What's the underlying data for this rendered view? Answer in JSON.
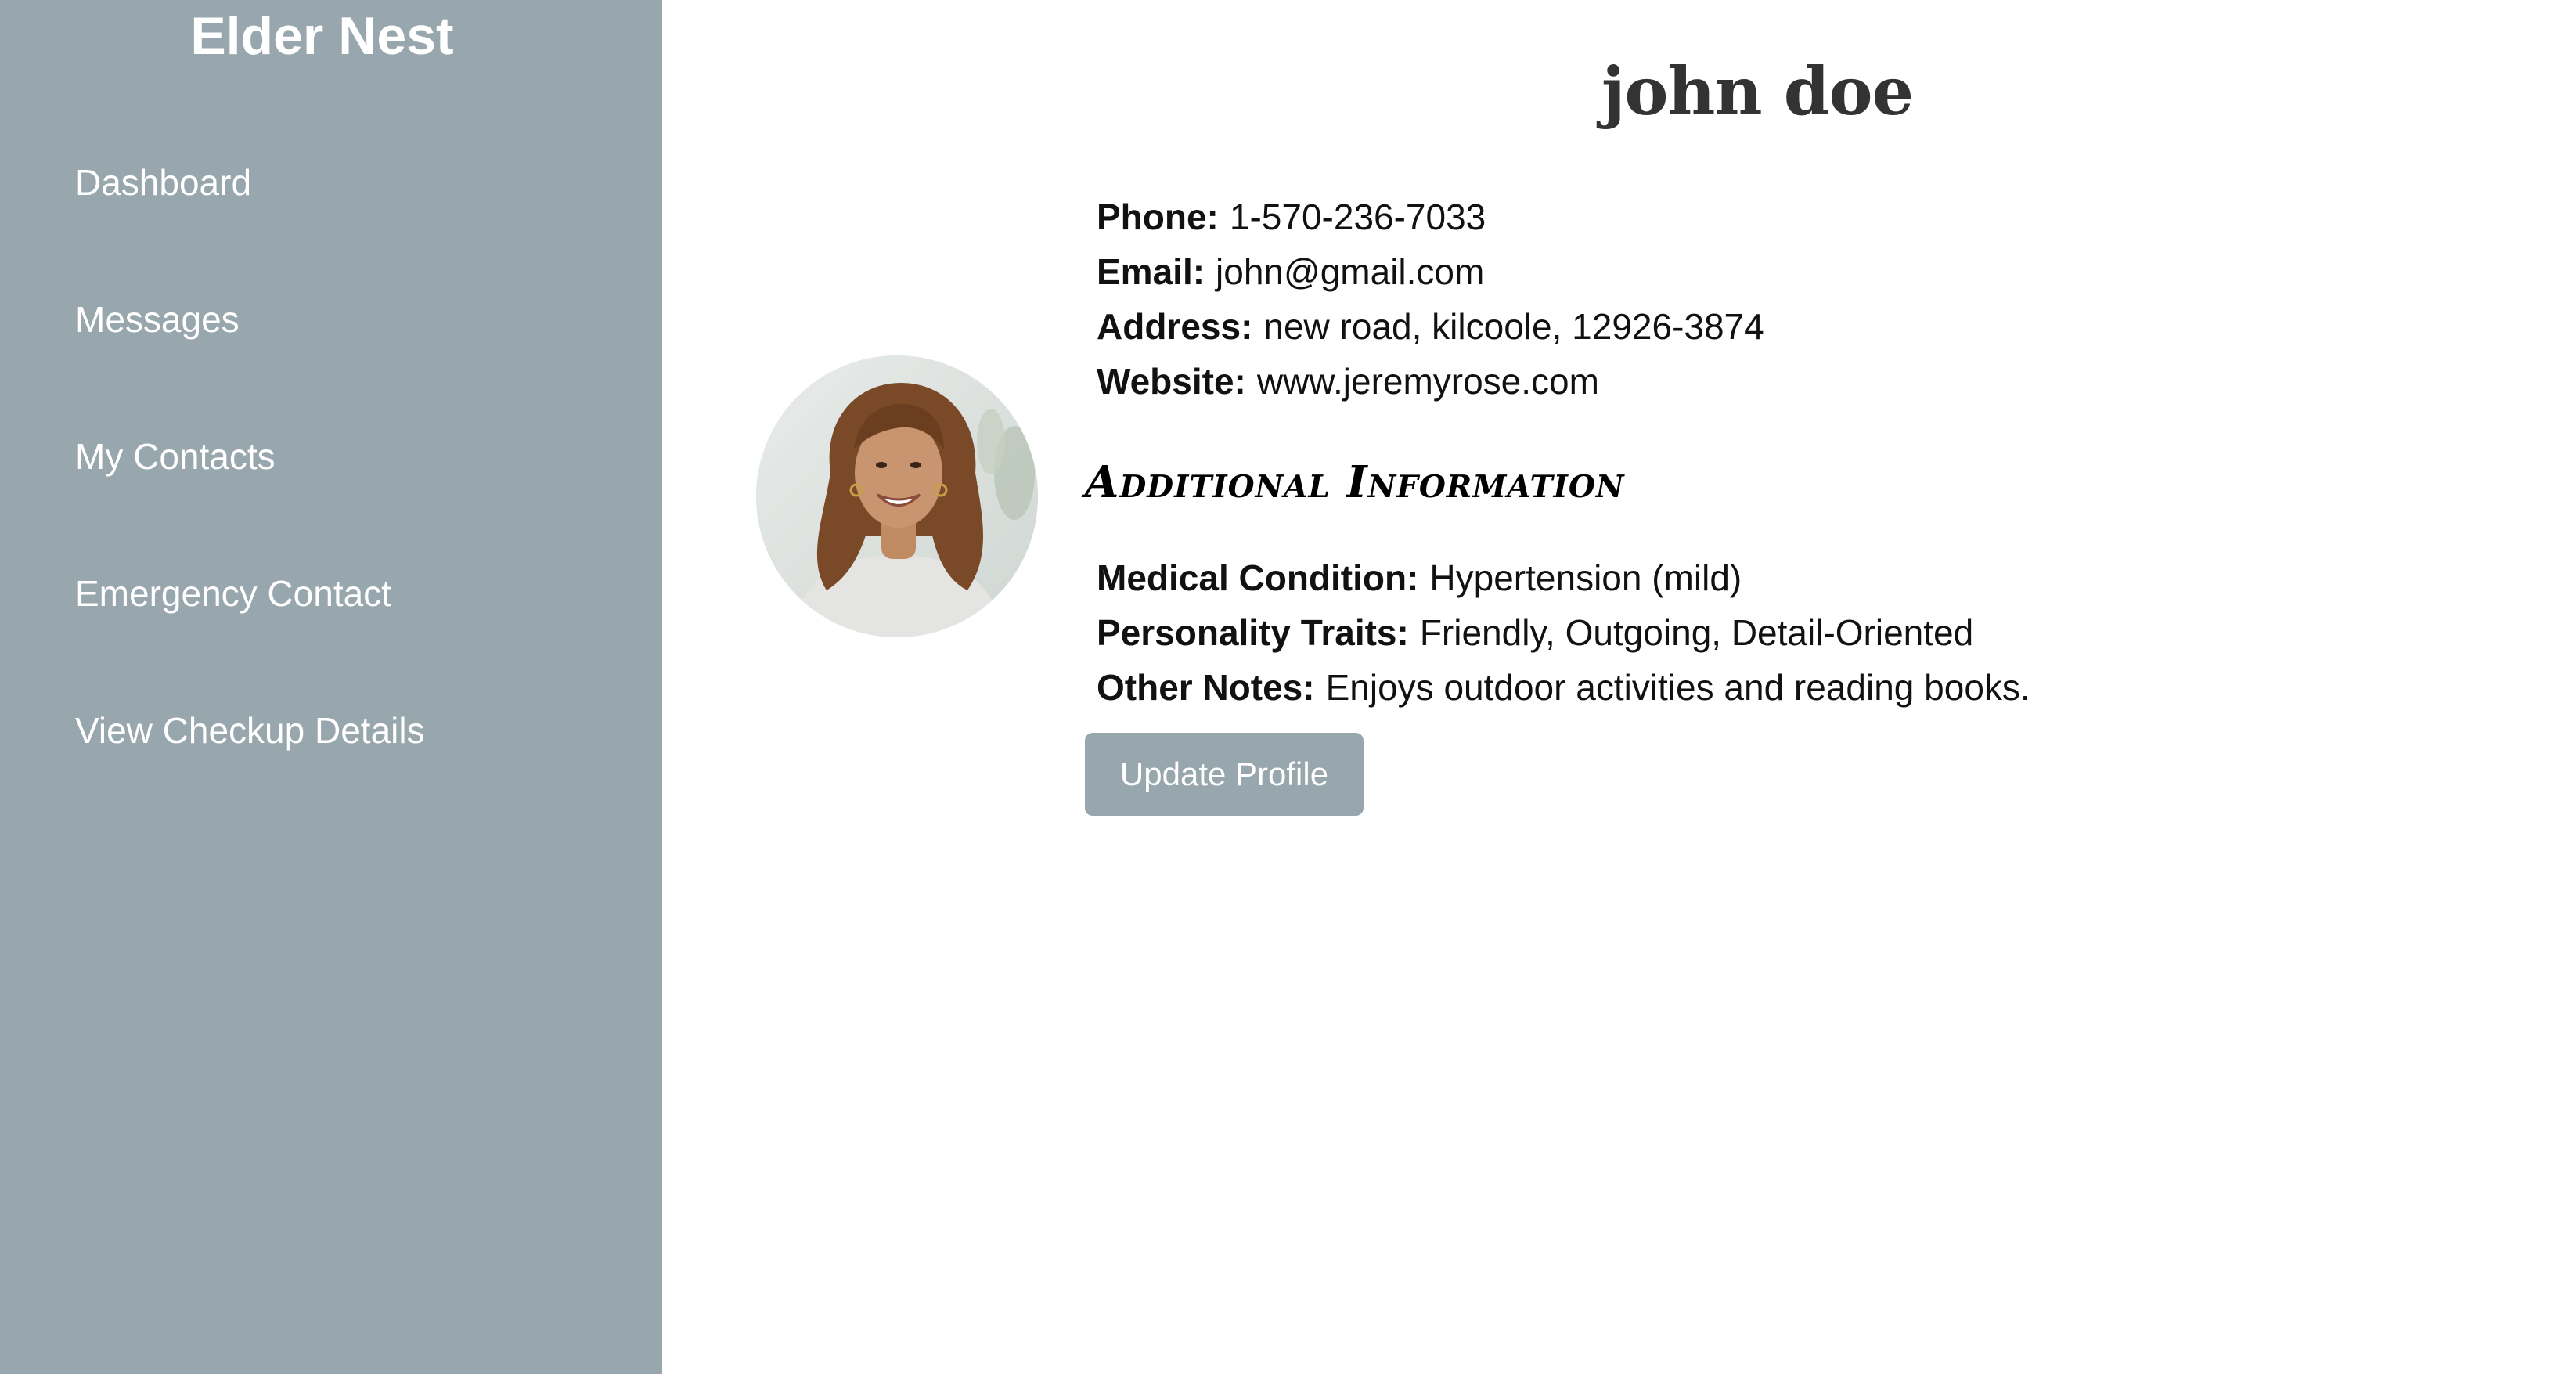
{
  "sidebar": {
    "brand": "Elder Nest",
    "items": [
      {
        "label": "Dashboard"
      },
      {
        "label": "Messages"
      },
      {
        "label": "My Contacts"
      },
      {
        "label": "Emergency Contact"
      },
      {
        "label": "View Checkup Details"
      }
    ],
    "background_color": "#98a6ad"
  },
  "profile": {
    "name": "john doe",
    "contact": [
      {
        "label": "Phone:",
        "value": "1-570-236-7033"
      },
      {
        "label": "Email:",
        "value": "john@gmail.com"
      },
      {
        "label": "Address:",
        "value": "new road, kilcoole, 12926-3874"
      },
      {
        "label": "Website:",
        "value": "www.jeremyrose.com"
      }
    ],
    "additional_heading": "Additional Information",
    "additional": [
      {
        "label": "Medical Condition:",
        "value": "Hypertension (mild)"
      },
      {
        "label": "Personality Traits:",
        "value": "Friendly, Outgoing, Detail-Oriented"
      },
      {
        "label": "Other Notes:",
        "value": "Enjoys outdoor activities and reading books."
      }
    ],
    "update_button": "Update Profile",
    "button_color": "#98a6ad"
  }
}
